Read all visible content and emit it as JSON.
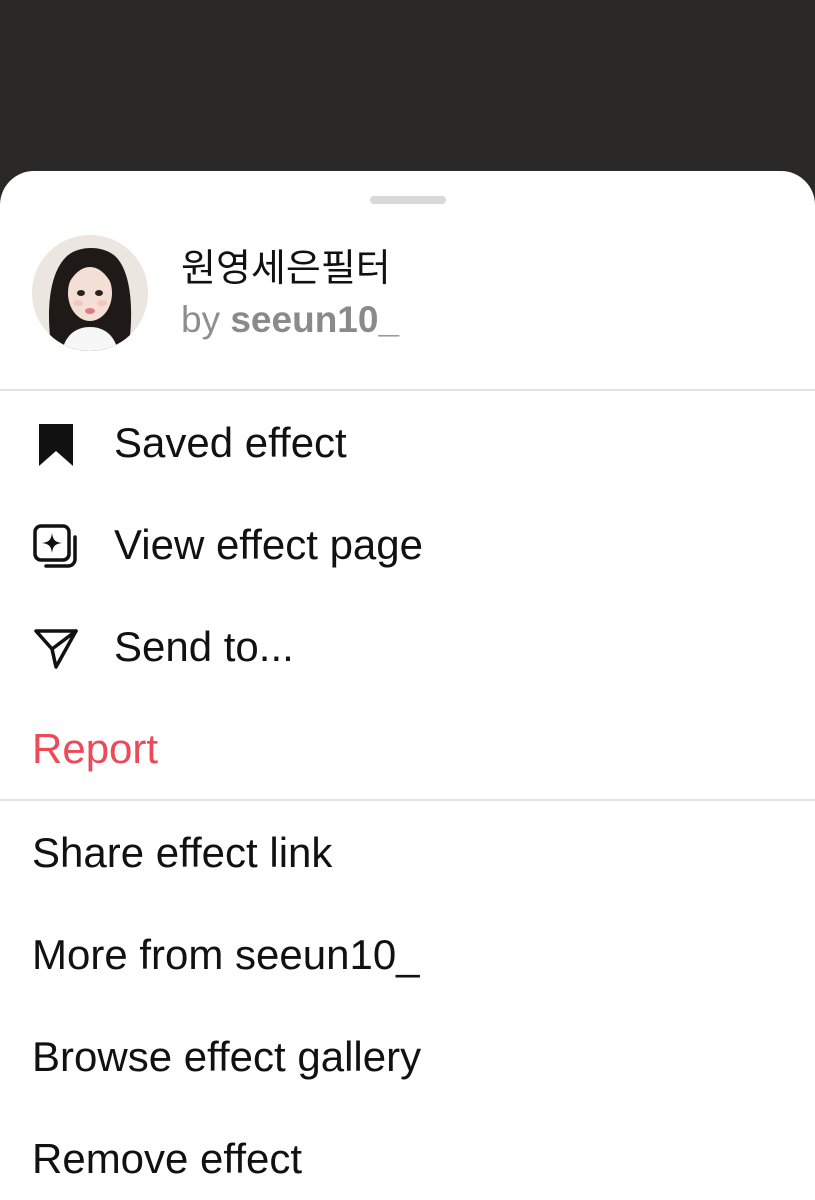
{
  "effect": {
    "name": "원영세은필터",
    "by_prefix": "by",
    "author": "seeun10_"
  },
  "menu_primary": [
    {
      "label": "Saved effect",
      "icon": "bookmark-filled-icon"
    },
    {
      "label": "View effect page",
      "icon": "effect-page-icon"
    },
    {
      "label": "Send to...",
      "icon": "paper-plane-icon"
    },
    {
      "label": "Report",
      "icon": "",
      "color": "#ed4956"
    }
  ],
  "menu_secondary": [
    {
      "label": "Share effect link"
    },
    {
      "label": "More from seeun10_"
    },
    {
      "label": "Browse effect gallery"
    },
    {
      "label": "Remove effect"
    }
  ],
  "colors": {
    "backdrop": "#2a2927",
    "sheet": "#ffffff",
    "danger": "#ed4956",
    "secondary_text": "#8e8e8e"
  }
}
